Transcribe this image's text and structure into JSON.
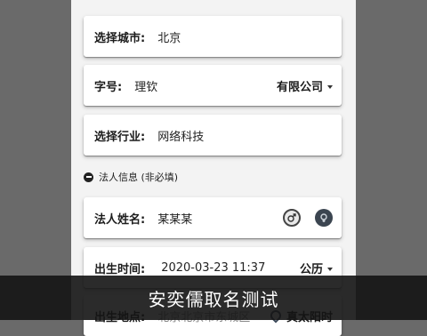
{
  "form": {
    "city": {
      "label": "选择城市:",
      "value": "北京"
    },
    "name_row": {
      "label": "字号:",
      "value": "理钦",
      "type_select": "有限公司"
    },
    "industry": {
      "label": "选择行业:",
      "value": "网络科技"
    },
    "section": {
      "title": "法人信息 (非必填)"
    },
    "legal_name": {
      "label": "法人姓名:",
      "value": "某某某",
      "male_icon": "male-icon",
      "female_icon": "female-icon"
    },
    "birth": {
      "label": "出生时间:",
      "value": "2020-03-23 11:37",
      "calendar_select": "公历"
    },
    "birthplace": {
      "label": "出生地点:",
      "value": "北京北京市东城区",
      "solar_time": "真太阳时"
    }
  },
  "caption": {
    "text": "安奕儒取名测试"
  },
  "colors": {
    "backdrop": "#6a6a6a",
    "page_bg": "#f3f3f3",
    "card_bg": "#ffffff",
    "caption_bg": "#141414"
  }
}
